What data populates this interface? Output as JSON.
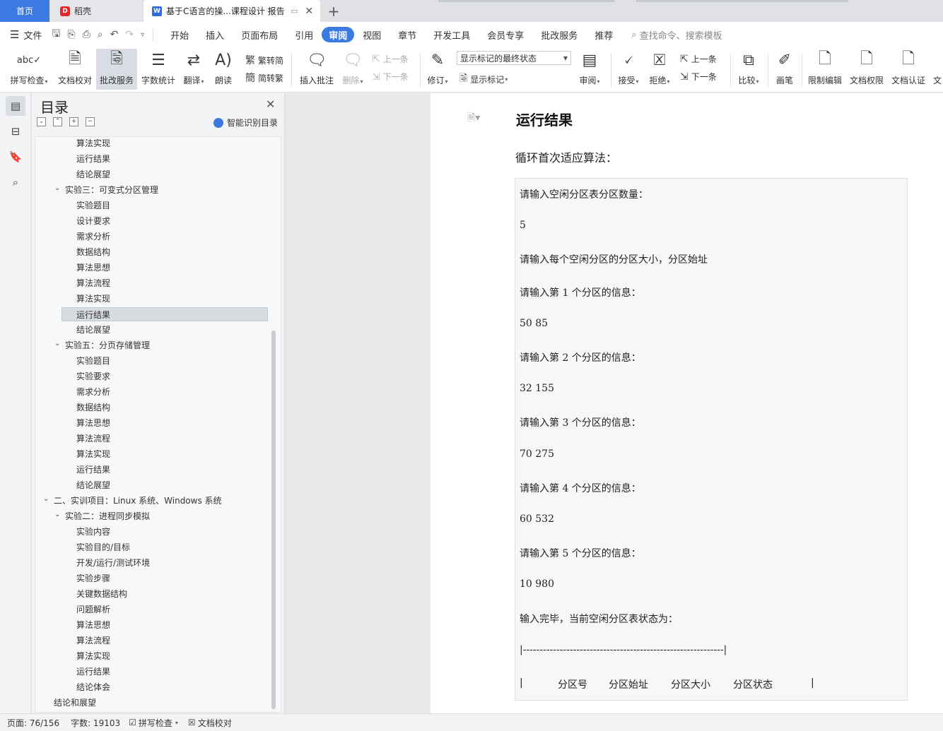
{
  "tabs": {
    "home": "首页",
    "daoke": "稻壳",
    "doc_title": "基于C语言的操...课程设计 报告"
  },
  "menu": {
    "file": "文件",
    "items": [
      "开始",
      "插入",
      "页面布局",
      "引用",
      "审阅",
      "视图",
      "章节",
      "开发工具",
      "会员专享",
      "批改服务",
      "推荐"
    ],
    "active": "审阅",
    "search_placeholder": "查找命令、搜索模板"
  },
  "ribbon": {
    "spell_check": "拼写检查",
    "doc_proofread": "文档校对",
    "correction_service": "批改服务",
    "word_count": "字数统计",
    "translate": "翻译",
    "read_aloud": "朗读",
    "trad_to_simp": "繁转简",
    "simp_to_trad": "简转繁",
    "insert_comment": "插入批注",
    "delete": "删除",
    "prev_comment": "上一条",
    "next_comment": "下一条",
    "track_changes": "修订",
    "markup_state": "显示标记的最终状态",
    "show_markup": "显示标记",
    "review": "审阅",
    "accept": "接受",
    "reject": "拒绝",
    "prev_change": "上一条",
    "next_change": "下一条",
    "compare": "比较",
    "pen": "画笔",
    "restrict_edit": "限制编辑",
    "doc_permission": "文档权限",
    "doc_cert": "文档认证",
    "more": "文"
  },
  "toc": {
    "title": "目录",
    "smart_detect": "智能识别目录",
    "items": [
      {
        "text": "算法实现",
        "level": 3
      },
      {
        "text": "运行结果",
        "level": 3
      },
      {
        "text": "结论展望",
        "level": 3
      },
      {
        "text": "实验三：可变式分区管理",
        "level": 2,
        "expanded": true
      },
      {
        "text": "实验题目",
        "level": 3
      },
      {
        "text": "设计要求",
        "level": 3
      },
      {
        "text": "需求分析",
        "level": 3
      },
      {
        "text": "数据结构",
        "level": 3
      },
      {
        "text": "算法思想",
        "level": 3
      },
      {
        "text": "算法流程",
        "level": 3
      },
      {
        "text": "算法实现",
        "level": 3
      },
      {
        "text": "运行结果",
        "level": 3,
        "selected": true
      },
      {
        "text": "结论展望",
        "level": 3
      },
      {
        "text": "实验五：分页存储管理",
        "level": 2,
        "expanded": true
      },
      {
        "text": "实验题目",
        "level": 3
      },
      {
        "text": "实验要求",
        "level": 3
      },
      {
        "text": "需求分析",
        "level": 3
      },
      {
        "text": "数据结构",
        "level": 3
      },
      {
        "text": "算法思想",
        "level": 3
      },
      {
        "text": "算法流程",
        "level": 3
      },
      {
        "text": "算法实现",
        "level": 3
      },
      {
        "text": "运行结果",
        "level": 3
      },
      {
        "text": "结论展望",
        "level": 3
      },
      {
        "text": "二、实训项目：Linux 系统、Windows 系统",
        "level": 1,
        "expanded": true
      },
      {
        "text": "实验二：进程同步模拟",
        "level": 2,
        "expanded": true
      },
      {
        "text": "实验内容",
        "level": 3
      },
      {
        "text": "实验目的/目标",
        "level": 3
      },
      {
        "text": "开发/运行/测试环境",
        "level": 3
      },
      {
        "text": "实验步骤",
        "level": 3
      },
      {
        "text": "关键数据结构",
        "level": 3
      },
      {
        "text": "问题解析",
        "level": 3
      },
      {
        "text": "算法思想",
        "level": 3
      },
      {
        "text": "算法流程",
        "level": 3
      },
      {
        "text": "算法实现",
        "level": 3
      },
      {
        "text": "运行结果",
        "level": 3
      },
      {
        "text": "结论体会",
        "level": 3
      },
      {
        "text": "结论和展望",
        "level": 1
      }
    ]
  },
  "document": {
    "heading": "运行结果",
    "paragraph": "循环首次适应算法：",
    "code_lines": [
      "请输入空闲分区表分区数量：",
      "5",
      "请输入每个空闲分区的分区大小，分区始址",
      "请输入第 1 个分区的信息：",
      "50 85",
      "请输入第 2 个分区的信息：",
      "32 155",
      "请输入第 3 个分区的信息：",
      "70 275",
      "请输入第 4 个分区的信息：",
      "60 532",
      "请输入第 5 个分区的信息：",
      "10 980",
      "输入完毕，当前空闲分区表状态为：",
      "|------------------------------------------------------------|"
    ],
    "table_header": {
      "left_bar": "|",
      "col1": "分区号",
      "col2": "分区始址",
      "col3": "分区大小",
      "col4": "分区状态",
      "right_bar": "|"
    }
  },
  "status": {
    "page": "页面: 76/156",
    "words": "字数: 19103",
    "spell_check": "拼写检查",
    "proofread": "文档校对"
  },
  "colors": {
    "accent": "#3b7ae0",
    "daoke_red": "#e8252a"
  }
}
